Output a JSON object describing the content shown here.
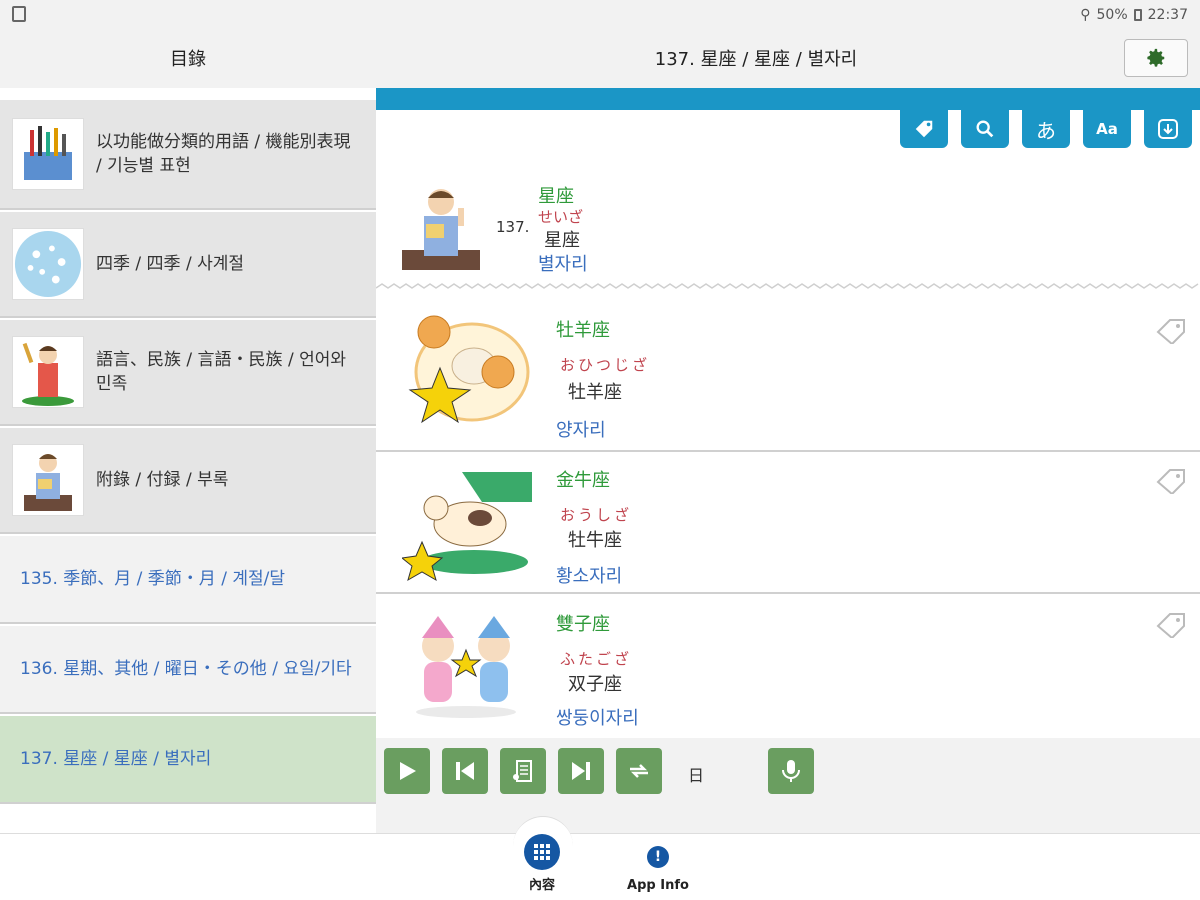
{
  "status_bar": {
    "battery": "50%",
    "time": "22:37"
  },
  "header": {
    "left_title": "目錄",
    "center_title": "137. 星座 / 星座 / 별자리",
    "settings_icon": "gear-icon"
  },
  "sidebar": {
    "categories": [
      {
        "label": "以功能做分類的用語 / 機能別表現 / 기능별 표현",
        "thumb": "tools-illustration"
      },
      {
        "label": "四季 / 四季 / 사계절",
        "thumb": "blossom-illustration"
      },
      {
        "label": "語言、民族 / 言語・民族 / 언어와 민족",
        "thumb": "kimono-girl-illustration"
      },
      {
        "label": "附錄 / 付録 / 부록",
        "thumb": "reading-boy-illustration"
      }
    ],
    "links": [
      {
        "label": "135. 季節、月 / 季節・月 / 계절/달"
      },
      {
        "label": "136. 星期、其他 / 曜日・その他 / 요일/기타"
      },
      {
        "label": "137. 星座 / 星座 / 별자리"
      }
    ]
  },
  "toolbar": {
    "buttons": [
      {
        "icon": "tag-icon"
      },
      {
        "icon": "search-icon"
      },
      {
        "label": "あ"
      },
      {
        "label": "Aa"
      },
      {
        "icon": "download-icon"
      }
    ]
  },
  "head_entry": {
    "number": "137.",
    "jp": "星座",
    "kana": "せいざ",
    "zh": "星座",
    "ko": "별자리"
  },
  "entries": [
    {
      "jp": "牡羊座",
      "kana": "おひつじざ",
      "zh": "牡羊座",
      "ko": "양자리",
      "figure": "ram-illustration"
    },
    {
      "jp": "金牛座",
      "kana": "おうしざ",
      "zh": "牡牛座",
      "ko": "황소자리",
      "figure": "bull-illustration"
    },
    {
      "jp": "雙子座",
      "kana": "ふたござ",
      "zh": "双子座",
      "ko": "쌍둥이자리",
      "figure": "twins-illustration"
    }
  ],
  "player": {
    "buttons": [
      "play-icon",
      "previous-icon",
      "transcript-icon",
      "next-icon",
      "repeat-icon",
      "mic-icon"
    ],
    "language_label": "日"
  },
  "bottom_nav": {
    "items": [
      {
        "label": "內容",
        "icon": "grid-icon"
      },
      {
        "label": "App Info",
        "icon": "info-icon"
      }
    ]
  },
  "colors": {
    "accent_blue": "#1b96c6",
    "player_green": "#6a9e60",
    "active_row": "#cfe3c9",
    "jp_green": "#2f9a3a",
    "kana_red": "#c0444e",
    "ko_blue": "#3a6ebd",
    "nav_blue": "#1557a3"
  }
}
